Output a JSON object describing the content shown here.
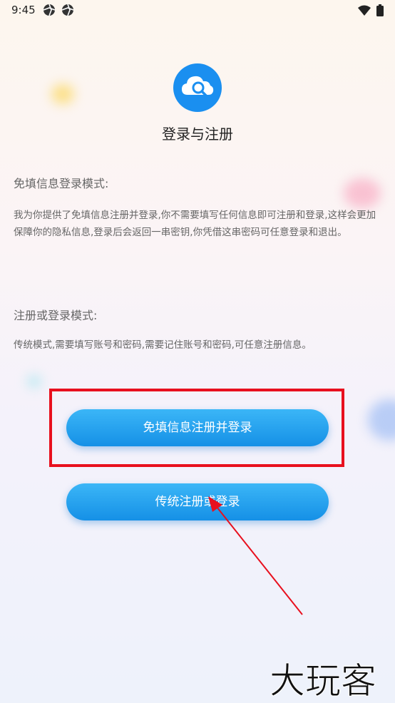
{
  "status_bar": {
    "time": "9:45",
    "left_icons": [
      "aperture-icon",
      "aperture-icon"
    ],
    "right_icons": [
      "wifi-icon",
      "battery-icon"
    ]
  },
  "header": {
    "logo_icon": "cloud-search-icon",
    "title": "登录与注册"
  },
  "sections": [
    {
      "title": "免填信息登录模式:",
      "body": "我为你提供了免填信息注册并登录,你不需要填写任何信息即可注册和登录,这样会更加保障你的隐私信息,登录后会返回一串密钥,你凭借这串密码可任意登录和退出。"
    },
    {
      "title": "注册或登录模式:",
      "body": "传统模式,需要填写账号和密码,需要记住账号和密码,可任意注册信息。"
    }
  ],
  "buttons": {
    "quick_register_label": "免填信息注册并登录",
    "traditional_register_label": "传统注册或登录"
  },
  "colors": {
    "accent": "#1e9bf0",
    "highlight": "#e8101e",
    "arrow": "#e8101e"
  },
  "watermark": {
    "text": "大玩客"
  }
}
